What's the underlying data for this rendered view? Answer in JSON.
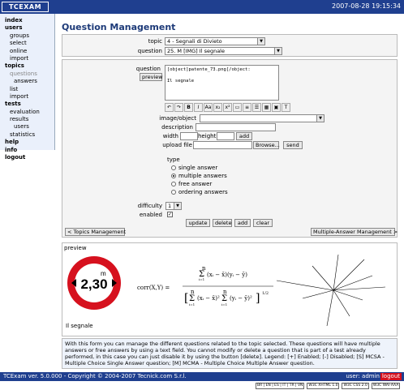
{
  "header": {
    "logo": "TCEXAM",
    "datetime": "2007-08-28 19:15:34"
  },
  "sidebar": {
    "items": [
      {
        "label": "index",
        "level": 0
      },
      {
        "label": "users",
        "level": 0
      },
      {
        "label": "groups",
        "level": 1
      },
      {
        "label": "select",
        "level": 1
      },
      {
        "label": "online",
        "level": 1
      },
      {
        "label": "import",
        "level": 1
      },
      {
        "label": "topics",
        "level": 0
      },
      {
        "label": "questions",
        "level": 1,
        "active": true
      },
      {
        "label": "answers",
        "level": 2
      },
      {
        "label": "list",
        "level": 1
      },
      {
        "label": "import",
        "level": 1
      },
      {
        "label": "tests",
        "level": 0
      },
      {
        "label": "evaluation",
        "level": 1
      },
      {
        "label": "results",
        "level": 1
      },
      {
        "label": "users",
        "level": 2
      },
      {
        "label": "statistics",
        "level": 1
      },
      {
        "label": "help",
        "level": 0
      },
      {
        "label": "info",
        "level": 0
      },
      {
        "label": "logout",
        "level": 0
      }
    ]
  },
  "page": {
    "title": "Question Management",
    "topic_label": "topic",
    "topic_value": "4 - Segnali di Divieto",
    "question_label": "question",
    "question_value": "25. M [IMG] Il segnale",
    "question_field_label": "question",
    "preview_button": "preview",
    "editor_line1": "[object]patente_73.png[/object:",
    "editor_line2": "Il segnale",
    "image_label": "image/object",
    "description_label": "description",
    "width_label": "width",
    "height_label": "height",
    "add_label": "add",
    "upload_label": "upload file",
    "browse_label": "Browse...",
    "send_label": "send",
    "type_label": "type",
    "type_options": [
      "single answer",
      "multiple answers",
      "free answer",
      "ordering answers"
    ],
    "type_selected": 1,
    "difficulty_label": "difficulty",
    "difficulty_value": "1",
    "enabled_label": "enabled",
    "update_label": "update",
    "delete_label": "delete",
    "add_button": "add",
    "clear_label": "clear",
    "prev_nav": "< Topics Management",
    "next_nav": "Multiple-Answer Management >",
    "preview_label": "preview",
    "sign_text": "2,30",
    "sign_unit": "m",
    "preview_caption": "Il segnale"
  },
  "help_text": "With this form you can manage the different questions related to the topic selected. These questions will have multiple answers or free answers by using a text field. You cannot modify or delete a question that is part of a test already performed, in this case you can just disable it by using the button [delete]. Legend: [+] Enabled; [-] Disabled; [S] MCSA - Multiple Choice Single Answer question; [M] MCMA - Multiple Choice Multiple Answer question.",
  "footer": {
    "left": "TCExam ver. 5.0.000 - Copyright © 2004-2007 Tecnick.com S.r.l.",
    "user": "user: admin",
    "logout": "logout"
  },
  "badges": [
    "BR | EN | ES | IT | TR | VN",
    "W3C XHTML 1.0",
    "W3C CSS 2.0",
    "W3C WAI-AAA"
  ]
}
